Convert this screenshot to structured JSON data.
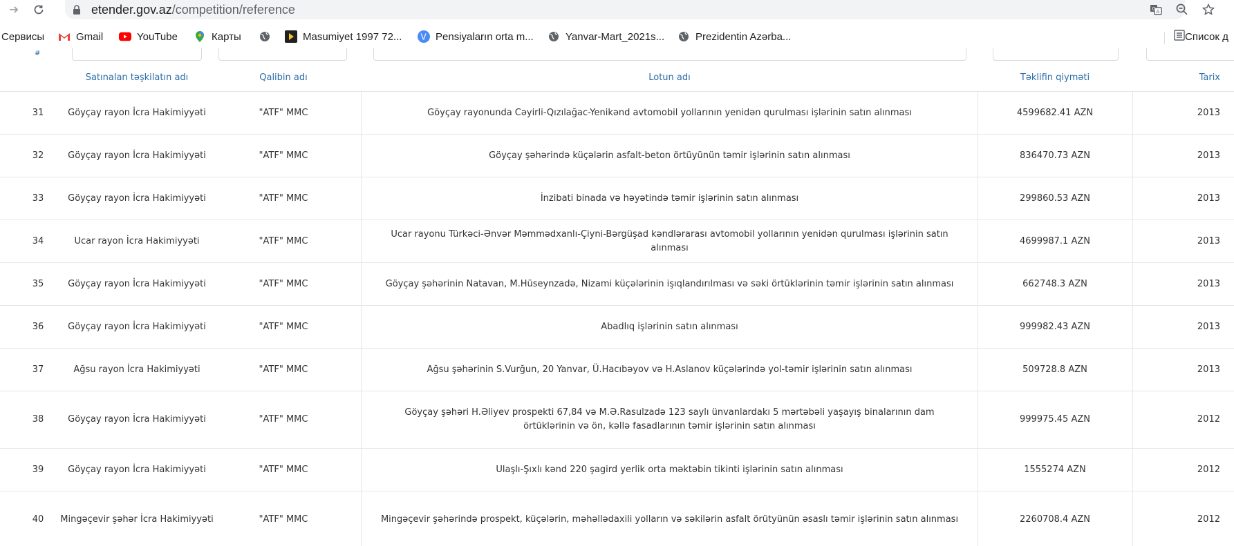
{
  "browser": {
    "url_host": "etender.gov.az",
    "url_path": "/competition/reference"
  },
  "bookmarks": [
    {
      "label": "Сервисы",
      "icon": "apps-icon"
    },
    {
      "label": "Gmail",
      "icon": "gmail-icon"
    },
    {
      "label": "YouTube",
      "icon": "youtube-icon"
    },
    {
      "label": "Карты",
      "icon": "maps-icon"
    },
    {
      "label": "",
      "icon": "globe-icon"
    },
    {
      "label": "Masumiyet 1997 72...",
      "icon": "video-icon"
    },
    {
      "label": "Pensiyaların orta m...",
      "icon": "v-logo-icon"
    },
    {
      "label": "Yanvar-Mart_2021s...",
      "icon": "globe-icon"
    },
    {
      "label": "Prezidentin Azərba...",
      "icon": "globe-icon"
    }
  ],
  "reading_list_label": "Список д",
  "table": {
    "hash_label": "#",
    "headers": {
      "org": "Satınalan təşkilatın adı",
      "template": "Qalibin adı",
      "lot": "Lotun adı",
      "price": "Təklifin qiyməti",
      "date": "Tarix"
    },
    "rows": [
      {
        "no": "31",
        "org": "Göyçay rayon İcra Hakimiyyəti",
        "template": "\"ATF\" MMC",
        "lot": "Göyçay rayonunda Cəyirli-Qızılağac-Yenikənd avtomobil yollarının yenidən qurulması işlərinin satın alınması",
        "price": "4599682.41 AZN",
        "date": "2013"
      },
      {
        "no": "32",
        "org": "Göyçay rayon İcra Hakimiyyəti",
        "template": "\"ATF\" MMC",
        "lot": "Göyçay şəhərində küçələrin asfalt-beton örtüyünün təmir işlərinin satın alınması",
        "price": "836470.73 AZN",
        "date": "2013"
      },
      {
        "no": "33",
        "org": "Göyçay rayon İcra Hakimiyyəti",
        "template": "\"ATF\" MMC",
        "lot": "İnzibati binada və həyətində təmir işlərinin satın alınması",
        "price": "299860.53 AZN",
        "date": "2013"
      },
      {
        "no": "34",
        "org": "Ucar rayon İcra Hakimiyyəti",
        "template": "\"ATF\" MMC",
        "lot": "Ucar rayonu Türkəci-Ənvər Məmmədxanlı-Çiyni-Bərgüşad kəndlərarası avtomobil yollarının yenidən qurulması işlərinin satın alınması",
        "price": "4699987.1 AZN",
        "date": "2013"
      },
      {
        "no": "35",
        "org": "Göyçay rayon İcra Hakimiyyəti",
        "template": "\"ATF\" MMC",
        "lot": "Göyçay şəhərinin Natavan, M.Hüseynzadə, Nizami küçələrinin işıqlandırılması və səki örtüklərinin təmir işlərinin satın alınması",
        "price": "662748.3 AZN",
        "date": "2013"
      },
      {
        "no": "36",
        "org": "Göyçay rayon İcra Hakimiyyəti",
        "template": "\"ATF\" MMC",
        "lot": "Abadlıq işlərinin satın alınması",
        "price": "999982.43 AZN",
        "date": "2013"
      },
      {
        "no": "37",
        "org": "Ağsu rayon İcra Hakimiyyəti",
        "template": "\"ATF\" MMC",
        "lot": "Ağsu şəhərinin S.Vurğun, 20 Yanvar, Ü.Hacıbəyov və H.Aslanov küçələrində yol-təmir işlərinin satın alınması",
        "price": "509728.8 AZN",
        "date": "2013"
      },
      {
        "no": "38",
        "org": "Göyçay rayon İcra Hakimiyyəti",
        "template": "\"ATF\" MMC",
        "lot": "Göyçay şəhəri H.Əliyev prospekti 67,84 və M.Ə.Rasulzadə 123 saylı ünvanlardakı 5 mərtəbəli yaşayış binalarının dam örtüklərinin və ön, kəllə fasadlarının təmir işlərinin satın alınması",
        "price": "999975.45 AZN",
        "date": "2012"
      },
      {
        "no": "39",
        "org": "Göyçay rayon İcra Hakimiyyəti",
        "template": "\"ATF\" MMC",
        "lot": "Ulaşlı-Şıxlı kənd 220 şagird yerlik orta məktəbin tikinti işlərinin satın alınması",
        "price": "1555274 AZN",
        "date": "2012"
      },
      {
        "no": "40",
        "org": "Mingəçevir şəhər İcra Hakimiyyəti",
        "template": "\"ATF\" MMC",
        "lot": "Mingəçevir şəhərində prospekt, küçələrin, məhəllədaxili yolların və səkilərin asfalt örütyünün əsaslı təmir işlərinin satın alınması",
        "price": "2260708.4 AZN",
        "date": "2012"
      }
    ]
  }
}
